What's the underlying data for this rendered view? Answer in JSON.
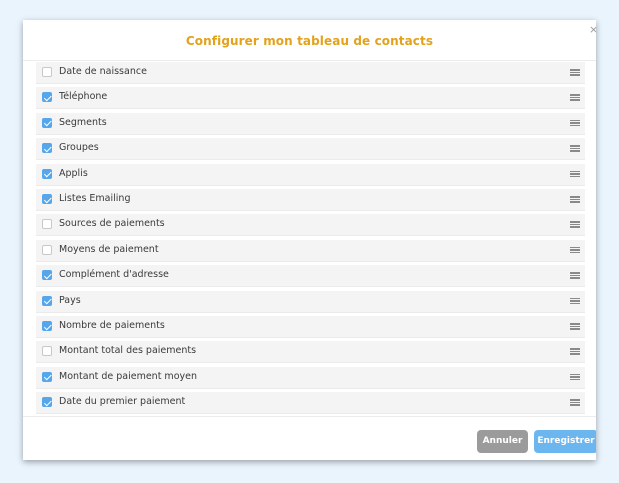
{
  "modal": {
    "title": "Configurer mon tableau de contacts",
    "close_glyph": "×"
  },
  "colors": {
    "title": "#e3a21a",
    "checkbox_checked": "#55a6ea",
    "cancel_button": "#9b9b9b",
    "save_button": "#6cb6ef"
  },
  "columns": [
    {
      "label": "Date de naissance",
      "checked": false
    },
    {
      "label": "Téléphone",
      "checked": true
    },
    {
      "label": "Segments",
      "checked": true
    },
    {
      "label": "Groupes",
      "checked": true
    },
    {
      "label": "Applis",
      "checked": true
    },
    {
      "label": "Listes Emailing",
      "checked": true
    },
    {
      "label": "Sources de paiements",
      "checked": false
    },
    {
      "label": "Moyens de paiement",
      "checked": false
    },
    {
      "label": "Complément d'adresse",
      "checked": true
    },
    {
      "label": "Pays",
      "checked": true
    },
    {
      "label": "Nombre de paiements",
      "checked": true
    },
    {
      "label": "Montant total des paiements",
      "checked": false
    },
    {
      "label": "Montant de paiement moyen",
      "checked": true
    },
    {
      "label": "Date du premier paiement",
      "checked": true
    }
  ],
  "icons": {
    "row_checkbox": "checkbox-icon",
    "row_handle": "drag-handle-icon",
    "close": "close-icon"
  },
  "footer": {
    "cancel_label": "Annuler",
    "save_label": "Enregistrer"
  }
}
